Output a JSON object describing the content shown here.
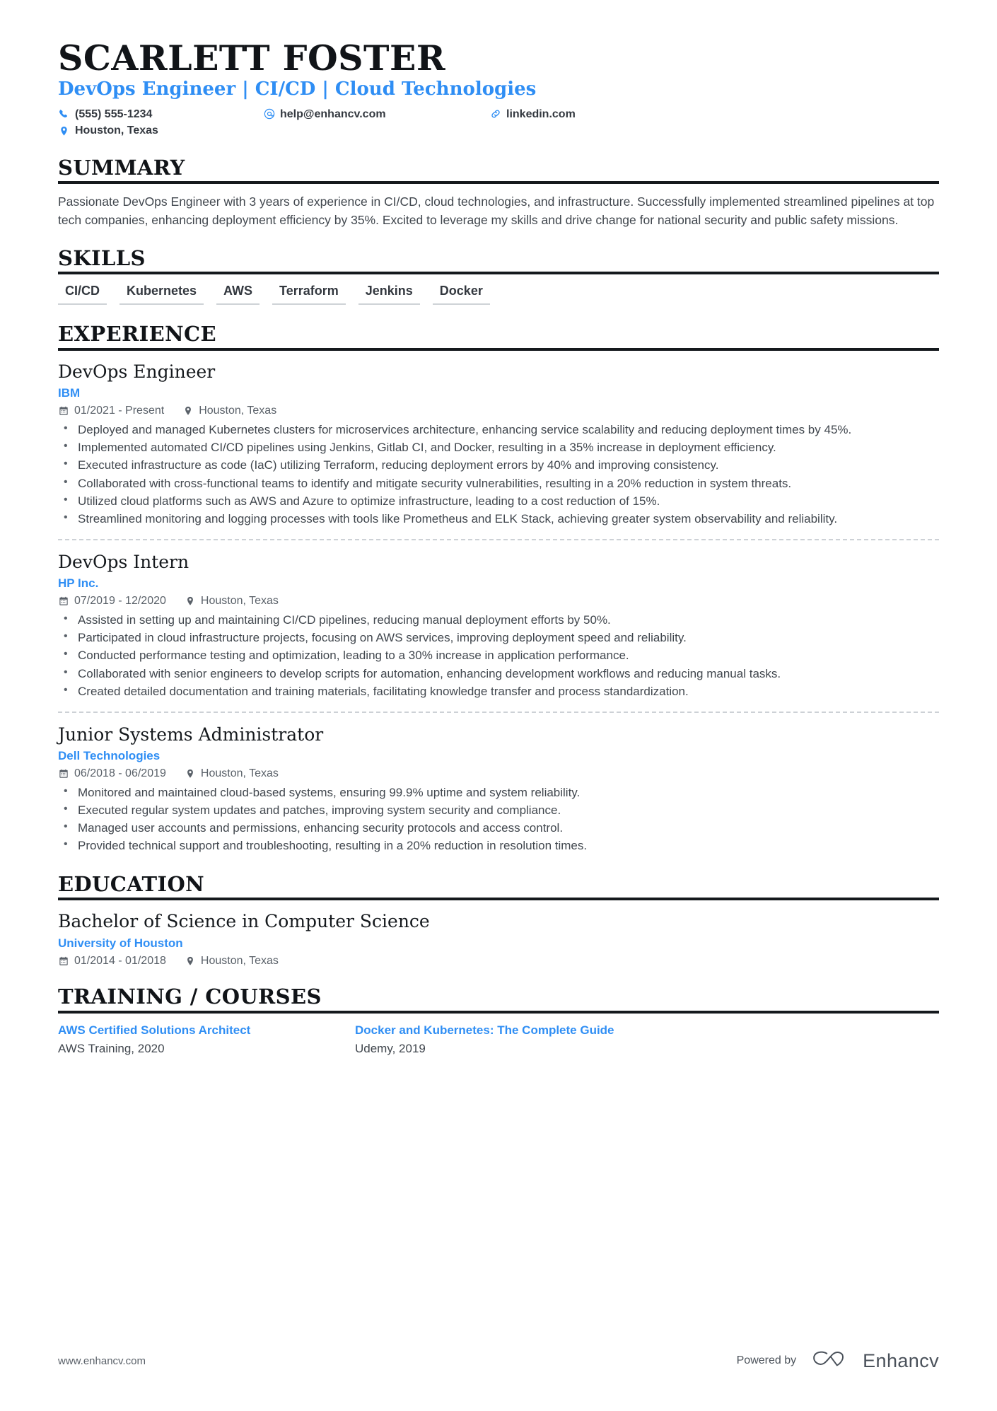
{
  "header": {
    "name": "SCARLETT FOSTER",
    "headline": "DevOps Engineer | CI/CD | Cloud Technologies",
    "accent_color": "#2f8ef4",
    "contacts": [
      {
        "icon": "phone-icon",
        "text": "(555) 555-1234"
      },
      {
        "icon": "email-icon",
        "text": "help@enhancv.com"
      },
      {
        "icon": "link-icon",
        "text": "linkedin.com"
      },
      {
        "icon": "location-pin-icon",
        "text": "Houston, Texas"
      }
    ]
  },
  "summary": {
    "title": "SUMMARY",
    "text": "Passionate DevOps Engineer with 3 years of experience in CI/CD, cloud technologies, and infrastructure. Successfully implemented streamlined pipelines at top tech companies, enhancing deployment efficiency by 35%. Excited to leverage my skills and drive change for national security and public safety missions."
  },
  "skills": {
    "title": "SKILLS",
    "items": [
      "CI/CD",
      "Kubernetes",
      "AWS",
      "Terraform",
      "Jenkins",
      "Docker"
    ]
  },
  "experience": {
    "title": "EXPERIENCE",
    "entries": [
      {
        "job_title": "DevOps Engineer",
        "company": "IBM",
        "dates": "01/2021 - Present",
        "location": "Houston, Texas",
        "bullets": [
          "Deployed and managed Kubernetes clusters for microservices architecture, enhancing service scalability and reducing deployment times by 45%.",
          "Implemented automated CI/CD pipelines using Jenkins, Gitlab CI, and Docker, resulting in a 35% increase in deployment efficiency.",
          "Executed infrastructure as code (IaC) utilizing Terraform, reducing deployment errors by 40% and improving consistency.",
          "Collaborated with cross-functional teams to identify and mitigate security vulnerabilities, resulting in a 20% reduction in system threats.",
          "Utilized cloud platforms such as AWS and Azure to optimize infrastructure, leading to a cost reduction of 15%.",
          "Streamlined monitoring and logging processes with tools like Prometheus and ELK Stack, achieving greater system observability and reliability."
        ]
      },
      {
        "job_title": "DevOps Intern",
        "company": "HP Inc.",
        "dates": "07/2019 - 12/2020",
        "location": "Houston, Texas",
        "bullets": [
          "Assisted in setting up and maintaining CI/CD pipelines, reducing manual deployment efforts by 50%.",
          "Participated in cloud infrastructure projects, focusing on AWS services, improving deployment speed and reliability.",
          "Conducted performance testing and optimization, leading to a 30% increase in application performance.",
          "Collaborated with senior engineers to develop scripts for automation, enhancing development workflows and reducing manual tasks.",
          "Created detailed documentation and training materials, facilitating knowledge transfer and process standardization."
        ]
      },
      {
        "job_title": "Junior Systems Administrator",
        "company": "Dell Technologies",
        "dates": "06/2018 - 06/2019",
        "location": "Houston, Texas",
        "bullets": [
          "Monitored and maintained cloud-based systems, ensuring 99.9% uptime and system reliability.",
          "Executed regular system updates and patches, improving system security and compliance.",
          "Managed user accounts and permissions, enhancing security protocols and access control.",
          "Provided technical support and troubleshooting, resulting in a 20% reduction in resolution times."
        ]
      }
    ]
  },
  "education": {
    "title": "EDUCATION",
    "entries": [
      {
        "degree": "Bachelor of Science in Computer Science",
        "school": "University of Houston",
        "dates": "01/2014 - 01/2018",
        "location": "Houston, Texas"
      }
    ]
  },
  "training": {
    "title": "TRAINING / COURSES",
    "courses": [
      {
        "name": "AWS Certified Solutions Architect",
        "provider": "AWS Training, 2020"
      },
      {
        "name": "Docker and Kubernetes: The Complete Guide",
        "provider": "Udemy, 2019"
      }
    ]
  },
  "footer": {
    "site": "www.enhancv.com",
    "powered_by": "Powered by",
    "brand": "Enhancv"
  }
}
